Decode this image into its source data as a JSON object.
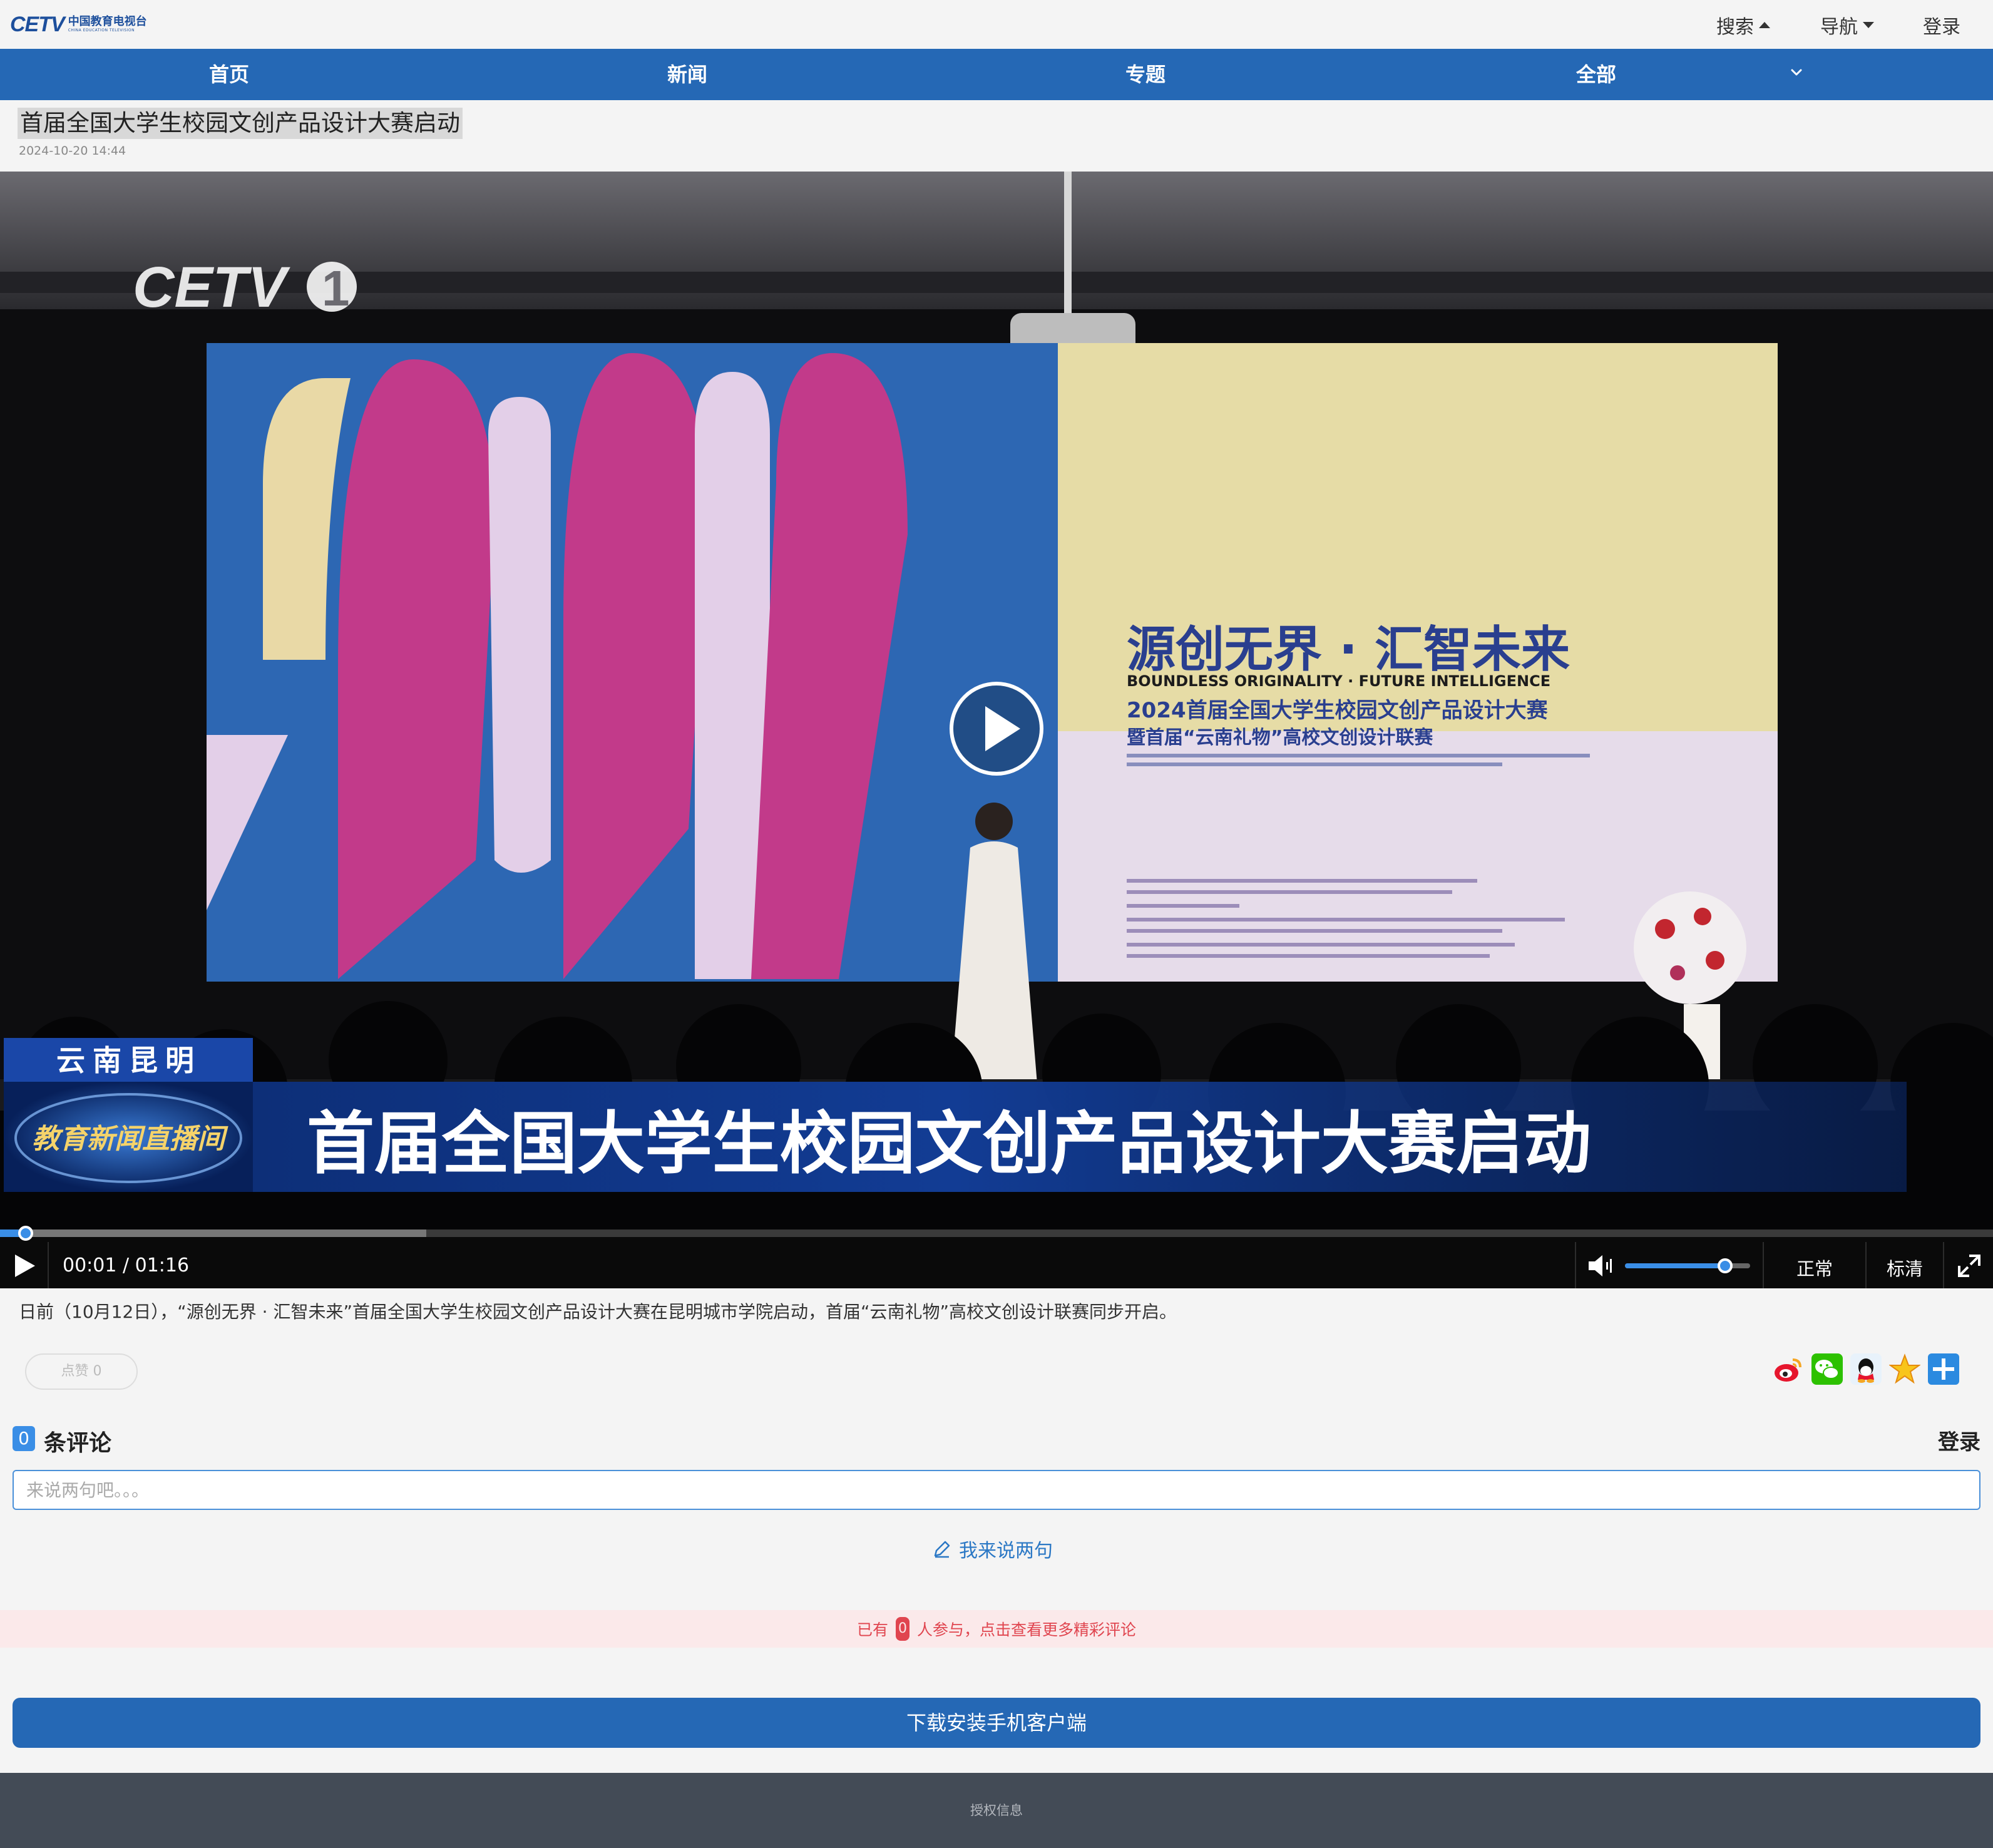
{
  "header": {
    "logo_mark": "CETV",
    "logo_cn": "中国教育电视台",
    "logo_en": "CHINA EDUCATION TELEVISION",
    "search_label": "搜索",
    "nav_label": "导航",
    "login_label": "登录"
  },
  "nav": {
    "items": [
      {
        "label": "首页"
      },
      {
        "label": "新闻"
      },
      {
        "label": "专题"
      },
      {
        "label": "全部"
      }
    ]
  },
  "article": {
    "title": "首届全国大学生校园文创产品设计大赛启动",
    "date": "2024-10-20 14:44",
    "summary": "日前（10月12日），“源创无界 · 汇智未来”首届全国大学生校园文创产品设计大赛在昆明城市学院启动，首届“云南礼物”高校文创设计联赛同步开启。"
  },
  "video": {
    "channel_logo": "CETV",
    "channel_number": "1",
    "screen_title_cn": "源创无界 · 汇智未来",
    "screen_title_en": "BOUNDLESS ORIGINALITY · FUTURE INTELLIGENCE",
    "screen_sub1": "2024首届全国大学生校园文创产品设计大赛",
    "screen_sub2": "暨首届“云南礼物”高校文创设计联赛",
    "location": "云南昆明",
    "program": "教育新闻直播间",
    "caption": "首届全国大学生校园文创产品设计大赛启动",
    "time_display": "00:01 / 01:16",
    "progress_fraction": 0.013,
    "buffered_fraction": 0.214,
    "volume_fraction": 0.8,
    "speed_label": "正常",
    "quality_label": "标清"
  },
  "actions": {
    "like_label": "点赞 0",
    "share_icons": [
      "weibo-icon",
      "wechat-icon",
      "qq-icon",
      "qzone-icon",
      "more-share-icon"
    ]
  },
  "comments": {
    "count": "0",
    "label": "条评论",
    "login_label": "登录",
    "placeholder": "来说两句吧。。。",
    "write_label": "我来说两句",
    "banner_prefix": "已有",
    "banner_count": "0",
    "banner_suffix": "人参与，点击查看更多精彩评论"
  },
  "download_label": "下载安装手机客户端",
  "footer": {
    "link": "授权信息"
  },
  "colors": {
    "brand_blue": "#2568b5",
    "accent_blue": "#3a8ee6",
    "alert_red": "#e0454f",
    "footer_bg": "#434b56"
  }
}
